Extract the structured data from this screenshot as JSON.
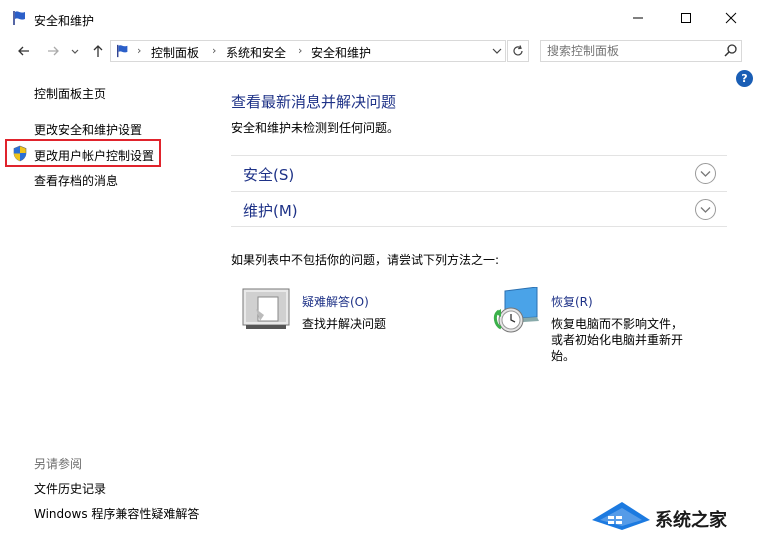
{
  "window": {
    "title": "安全和维护"
  },
  "address": {
    "crumbs": [
      "控制面板",
      "系统和安全",
      "安全和维护"
    ],
    "search_placeholder": "搜索控制面板"
  },
  "sidebar": {
    "home": "控制面板主页",
    "items": [
      "更改安全和维护设置",
      "更改用户帐户控制设置",
      "查看存档的消息"
    ],
    "see_also_label": "另请参阅",
    "see_also": [
      "文件历史记录",
      "Windows 程序兼容性疑难解答"
    ]
  },
  "main": {
    "title": "查看最新消息并解决问题",
    "status": "安全和维护未检测到任何问题。",
    "sections": [
      "安全(S)",
      "维护(M)"
    ],
    "tip": "如果列表中不包括你的问题，请尝试下列方法之一:",
    "tools": [
      {
        "label": "疑难解答(O)",
        "desc": [
          "查找并解决问题"
        ]
      },
      {
        "label": "恢复(R)",
        "desc": [
          "恢复电脑而不影响文件，",
          "或者初始化电脑并重新开",
          "始。"
        ]
      }
    ]
  },
  "watermark": {
    "text": "系统之家"
  },
  "icons": {
    "flag": "control-panel-flag-icon",
    "shield": "uac-shield-icon",
    "help": "help-icon"
  },
  "colors": {
    "link": "#1e3287",
    "highlight_box": "#e0232c",
    "help": "#1a5eb5"
  }
}
